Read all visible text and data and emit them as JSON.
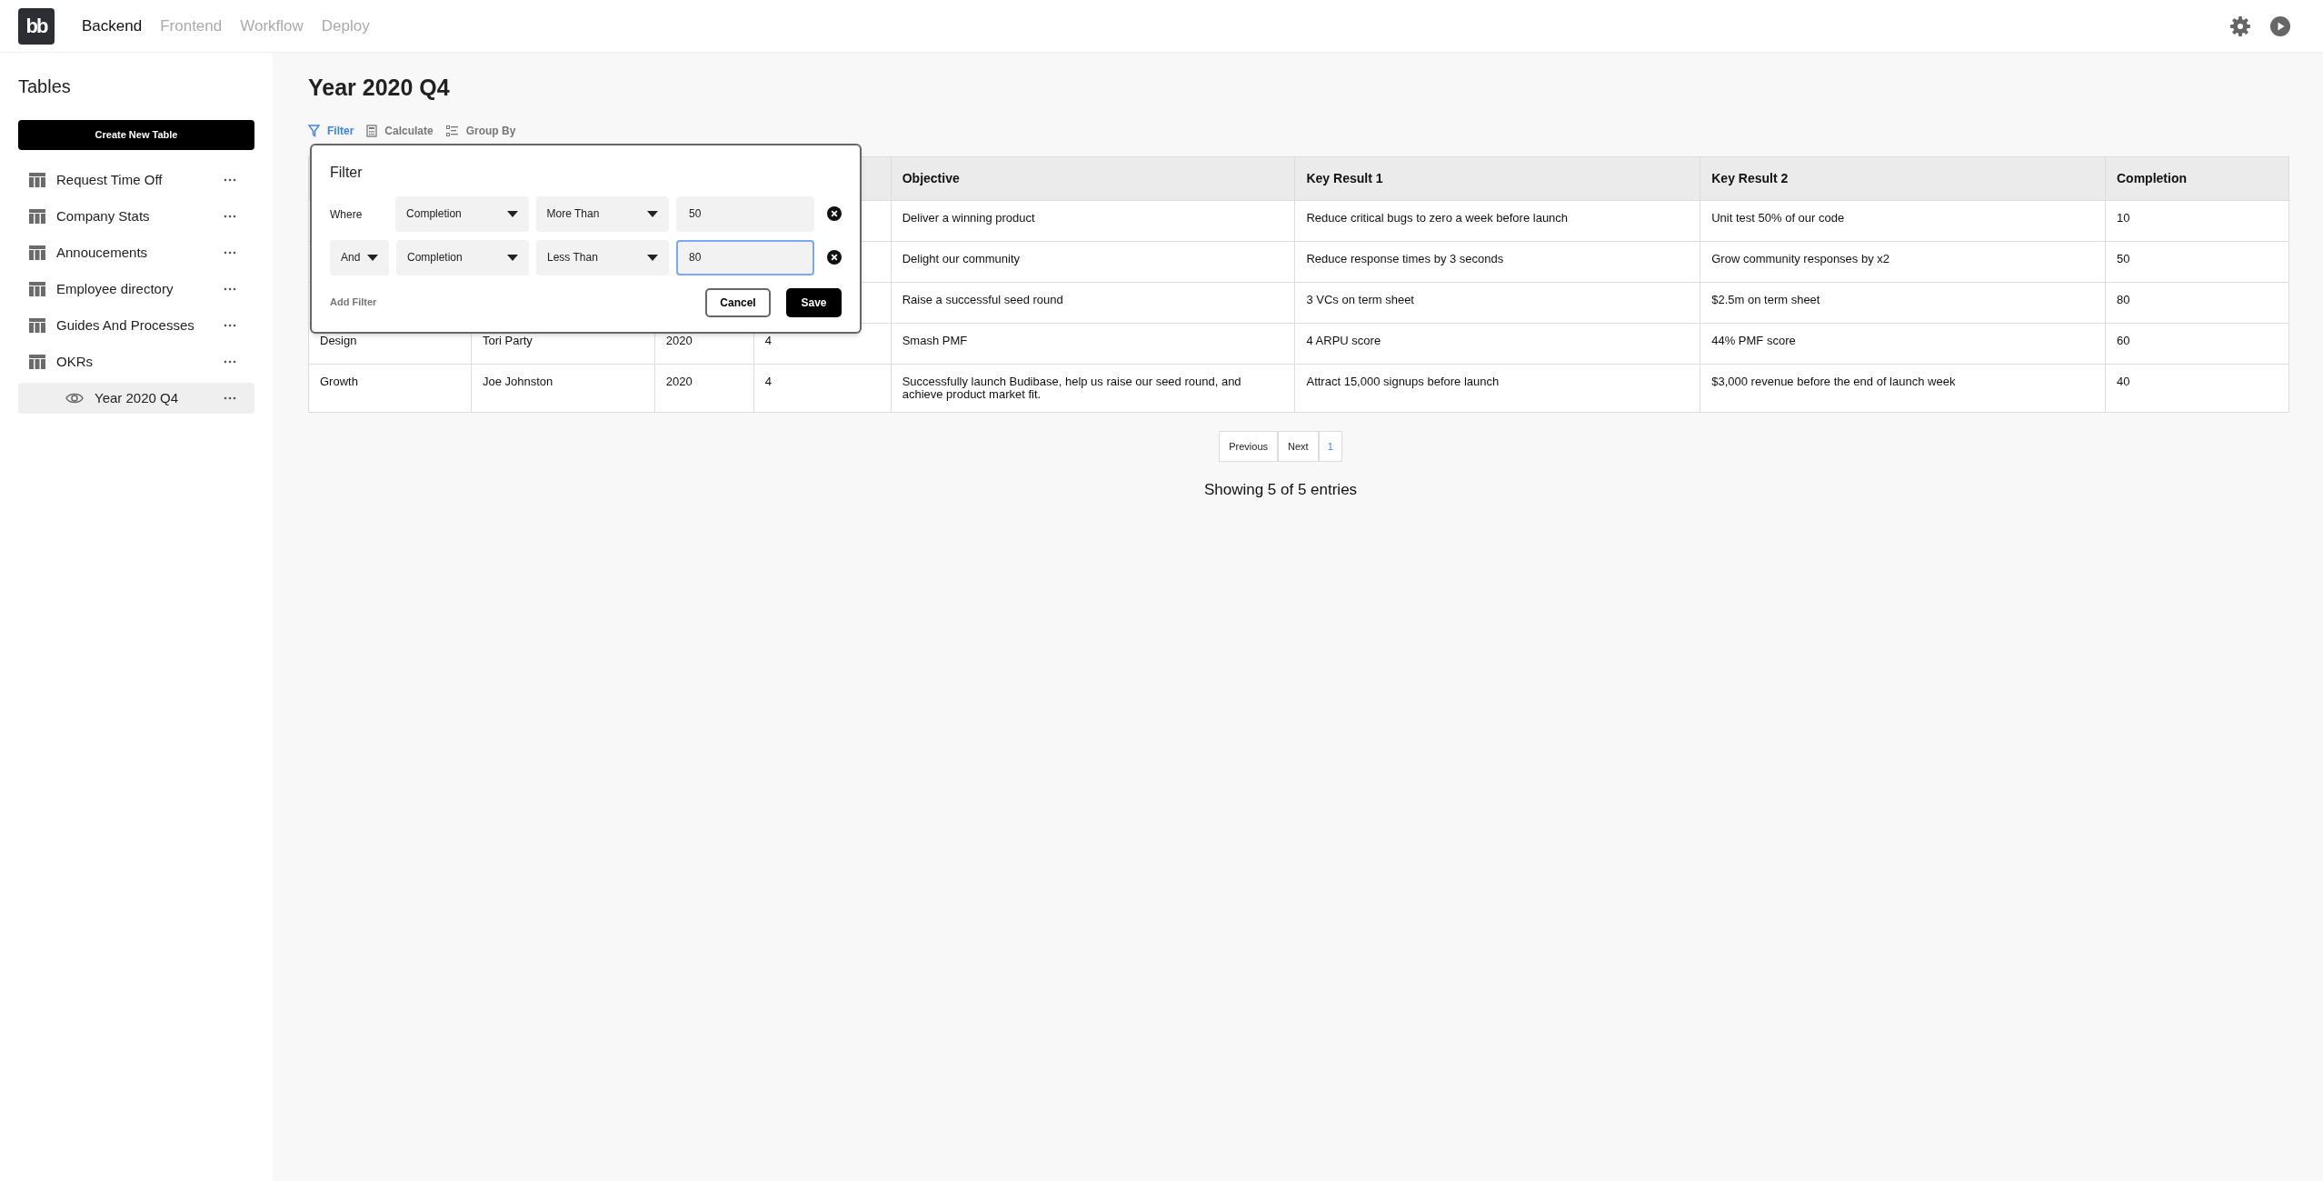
{
  "logo_text": "bb",
  "nav": [
    {
      "label": "Backend",
      "selected": true
    },
    {
      "label": "Frontend",
      "selected": false
    },
    {
      "label": "Workflow",
      "selected": false
    },
    {
      "label": "Deploy",
      "selected": false
    }
  ],
  "sidebar": {
    "title": "Tables",
    "create_button": "Create New Table",
    "items": [
      {
        "label": "Request Time Off",
        "kind": "table",
        "selected": false
      },
      {
        "label": "Company Stats",
        "kind": "table",
        "selected": false
      },
      {
        "label": "Annoucements",
        "kind": "table",
        "selected": false
      },
      {
        "label": "Employee directory",
        "kind": "table",
        "selected": false
      },
      {
        "label": "Guides And Processes",
        "kind": "table",
        "selected": false
      },
      {
        "label": "OKRs",
        "kind": "table",
        "selected": false,
        "children": [
          {
            "label": "Year 2020 Q4",
            "kind": "view",
            "selected": true
          }
        ]
      }
    ]
  },
  "page_title": "Year 2020 Q4",
  "toolbar": [
    {
      "label": "Filter",
      "kind": "filter",
      "selected": true
    },
    {
      "label": "Calculate",
      "kind": "calculate",
      "selected": false
    },
    {
      "label": "Group By",
      "kind": "group",
      "selected": false
    }
  ],
  "filter_popup": {
    "title": "Filter",
    "rows": [
      {
        "conjunction": "Where",
        "kind": "label",
        "field": "Completion",
        "operator": "More Than",
        "value": "50",
        "focused": false
      },
      {
        "conjunction": "And",
        "kind": "select",
        "field": "Completion",
        "operator": "Less Than",
        "value": "80",
        "focused": true
      }
    ],
    "add_filter": "Add Filter",
    "cancel": "Cancel",
    "save": "Save"
  },
  "table": {
    "columns": [
      null,
      null,
      null,
      null,
      "Objective",
      "Key Result 1",
      "Key Result 2",
      "Completion"
    ],
    "rows": [
      [
        null,
        null,
        null,
        null,
        "Deliver a winning product",
        "Reduce critical bugs to zero a week before launch",
        "Unit test 50% of our code",
        "10"
      ],
      [
        null,
        null,
        null,
        null,
        "Delight our community",
        "Reduce response times by 3 seconds",
        "Grow community responses by x2",
        "50"
      ],
      [
        null,
        null,
        null,
        null,
        "Raise a successful seed round",
        "3 VCs on term sheet",
        "$2.5m on term sheet",
        "80"
      ],
      [
        "Design",
        "Tori Party",
        "2020",
        "4",
        "Smash PMF",
        "4 ARPU score",
        "44% PMF score",
        "60"
      ],
      [
        "Growth",
        "Joe Johnston",
        "2020",
        "4",
        "Successfully launch Budibase, help us raise our seed round, and achieve product market fit.",
        "Attract 15,000 signups before launch",
        "$3,000 revenue before the end of launch week",
        "40"
      ]
    ]
  },
  "pagination": {
    "previous": "Previous",
    "next": "Next",
    "pages": [
      {
        "label": "1",
        "selected": true
      }
    ]
  },
  "entries_text": "Showing 5 of 5 entries"
}
